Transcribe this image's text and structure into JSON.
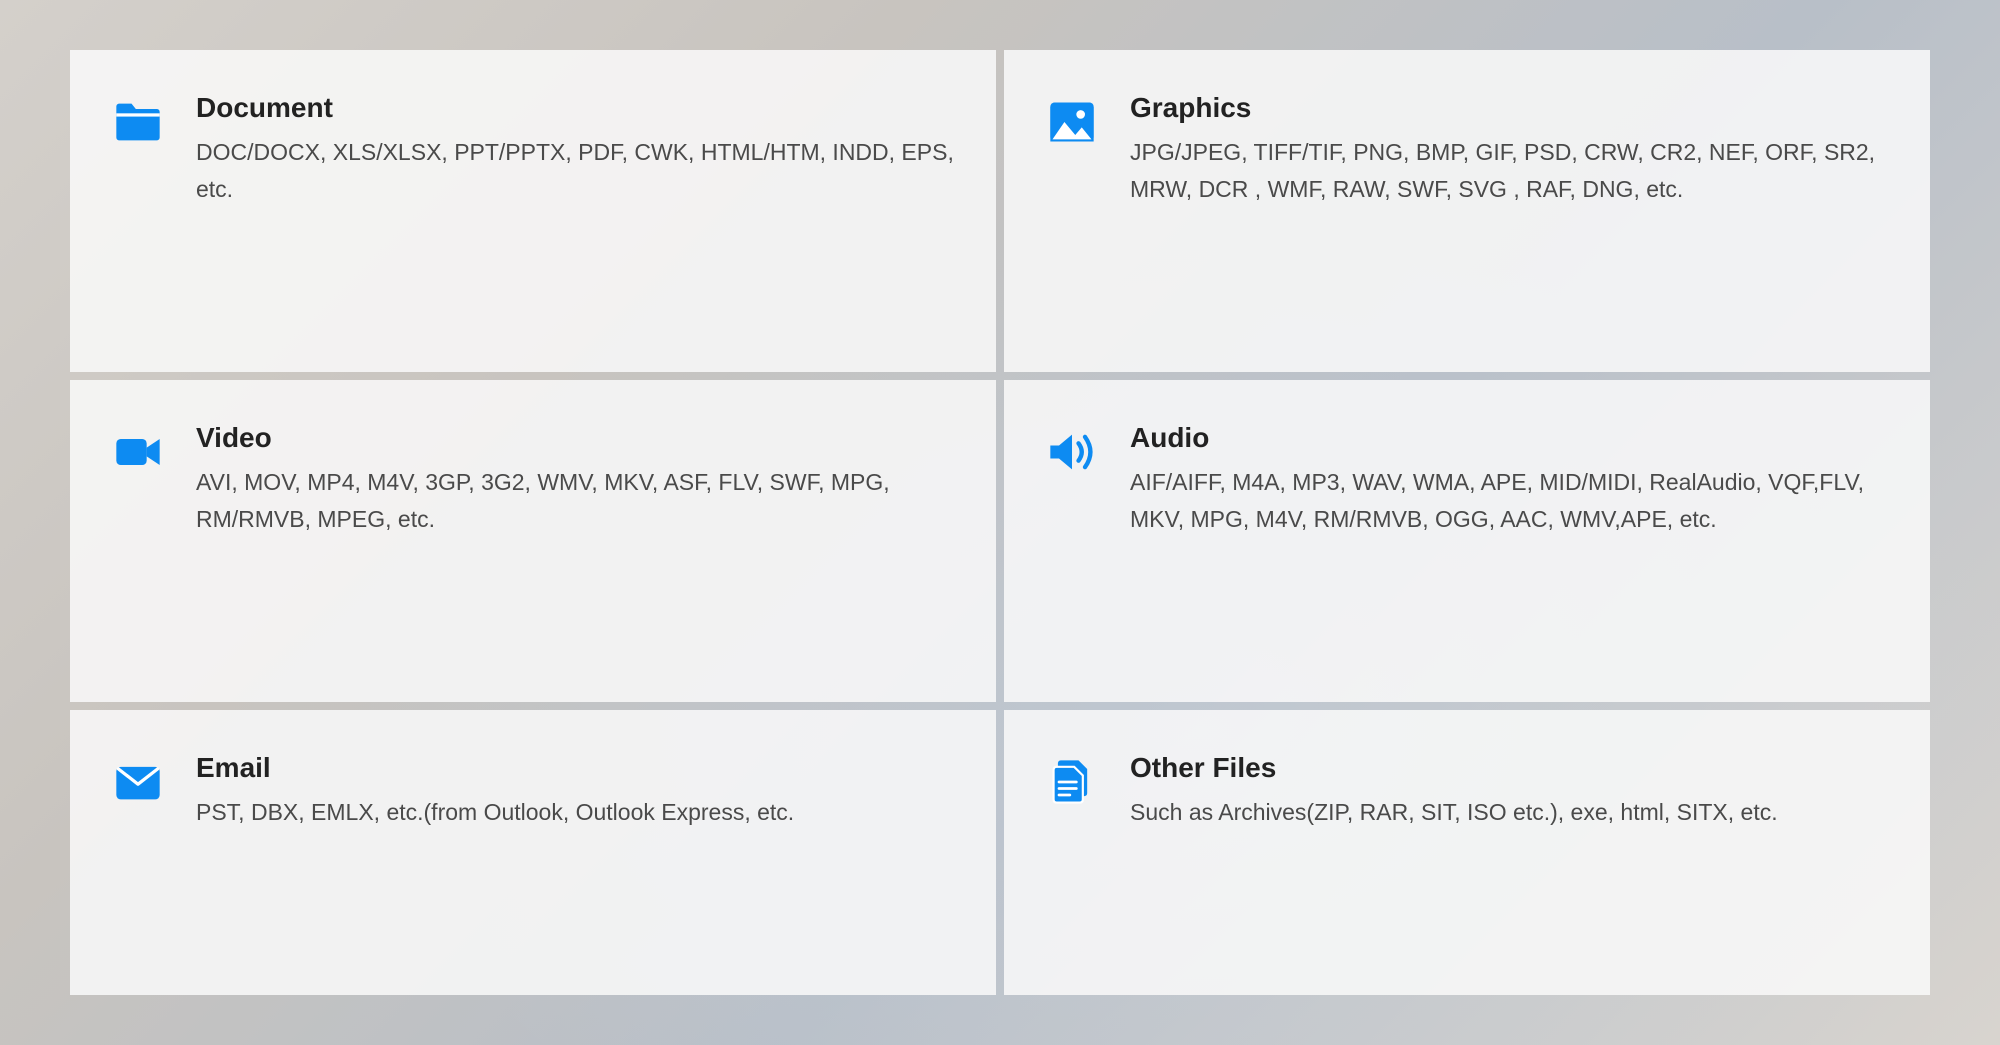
{
  "accent_color": "#0d8bf2",
  "cards": [
    {
      "key": "document",
      "title": "Document",
      "description": "DOC/DOCX, XLS/XLSX, PPT/PPTX, PDF, CWK, HTML/HTM, INDD, EPS, etc."
    },
    {
      "key": "graphics",
      "title": "Graphics",
      "description": "JPG/JPEG, TIFF/TIF, PNG, BMP, GIF, PSD, CRW, CR2, NEF, ORF, SR2, MRW, DCR , WMF, RAW, SWF, SVG , RAF, DNG, etc."
    },
    {
      "key": "video",
      "title": "Video",
      "description": "AVI, MOV, MP4, M4V, 3GP, 3G2, WMV, MKV, ASF, FLV, SWF, MPG, RM/RMVB, MPEG, etc."
    },
    {
      "key": "audio",
      "title": "Audio",
      "description": "AIF/AIFF, M4A, MP3, WAV, WMA, APE, MID/MIDI, RealAudio, VQF,FLV, MKV, MPG, M4V, RM/RMVB, OGG, AAC, WMV,APE, etc."
    },
    {
      "key": "email",
      "title": "Email",
      "description": "PST, DBX, EMLX, etc.(from Outlook, Outlook Express, etc."
    },
    {
      "key": "other",
      "title": "Other Files",
      "description": "Such as Archives(ZIP, RAR, SIT, ISO etc.), exe, html, SITX, etc."
    }
  ]
}
